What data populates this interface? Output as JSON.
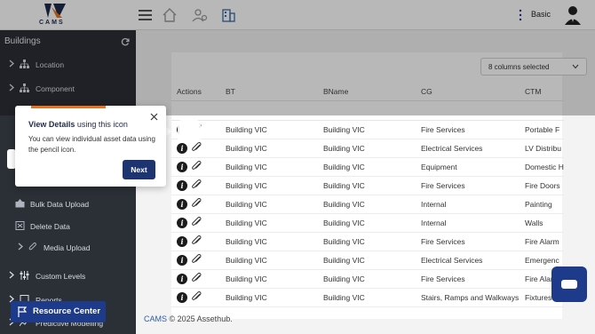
{
  "header": {
    "logo_text": "CAMS",
    "user_label": "Basic",
    "icons": [
      "menu-icon",
      "home-icon",
      "users-icon",
      "building-icon"
    ]
  },
  "sidebar": {
    "title": "Buildings",
    "items": [
      {
        "label": "Location",
        "icon": "hierarchy-icon"
      },
      {
        "label": "Component",
        "icon": "hierarchy-icon"
      },
      {
        "label": "Bulk Data Upload",
        "icon": "upload-icon"
      },
      {
        "label": "Delete Data",
        "icon": "delete-icon"
      },
      {
        "label": "Media Upload",
        "icon": "paperclip-icon"
      },
      {
        "label": "Custom Levels",
        "icon": "sliders-icon"
      },
      {
        "label": "Reports",
        "icon": "report-icon"
      },
      {
        "label": "Predictive Modelling",
        "icon": "chart-icon"
      }
    ]
  },
  "table": {
    "column_selector": "8 columns selected",
    "headers": [
      "Actions",
      "BT",
      "BName",
      "CG",
      "CTM"
    ],
    "rows": [
      [
        "Building VIC",
        "Building VIC",
        "Fire Services",
        "Portable F"
      ],
      [
        "Building VIC",
        "Building VIC",
        "Electrical Services",
        "LV Distribu"
      ],
      [
        "Building VIC",
        "Building VIC",
        "Equipment",
        "Domestic H"
      ],
      [
        "Building VIC",
        "Building VIC",
        "Fire Services",
        "Fire Doors"
      ],
      [
        "Building VIC",
        "Building VIC",
        "Internal",
        "Painting"
      ],
      [
        "Building VIC",
        "Building VIC",
        "Internal",
        "Walls"
      ],
      [
        "Building VIC",
        "Building VIC",
        "Fire Services",
        "Fire Alarm"
      ],
      [
        "Building VIC",
        "Building VIC",
        "Electrical Services",
        "Emergenc"
      ],
      [
        "Building VIC",
        "Building VIC",
        "Fire Services",
        "Fire Alar"
      ],
      [
        "Building VIC",
        "Building VIC",
        "Stairs, Ramps and Walkways",
        "Fixtures"
      ]
    ]
  },
  "popover": {
    "title_bold": "View Details",
    "title_rest": " using this icon",
    "body": "You can view individual asset data using the pencil icon.",
    "next_label": "Next"
  },
  "footer": {
    "brand": "CAMS",
    "text": " © 2025 Assethub."
  },
  "resource_center": {
    "label": "Resource Center"
  },
  "colors": {
    "accent": "#e8731d",
    "primary": "#1e3a8a",
    "sidebar": "#2b2f36"
  }
}
